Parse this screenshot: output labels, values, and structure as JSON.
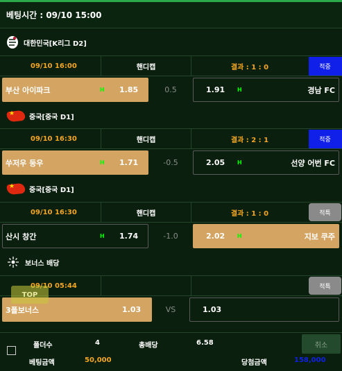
{
  "header": {
    "title": "베팅시간 : 09/10 15:00"
  },
  "matches": [
    {
      "league": "대한민국[K리그 D2]",
      "league_icon": "k-league-icon",
      "time": "09/10 16:00",
      "type": "핸디캡",
      "result": "결과 : 1 : 0",
      "status": "적중",
      "status_color": "#1020e8",
      "home": {
        "team": "부산 아이파크",
        "mark": "H",
        "odd": "1.85",
        "selected": true
      },
      "handicap": "0.5",
      "away": {
        "team": "경남 FC",
        "mark": "H",
        "odd": "1.91",
        "selected": false
      }
    },
    {
      "league": "중국[중국 D1]",
      "league_icon": "china-flag-icon",
      "time": "09/10 16:30",
      "type": "핸디캡",
      "result": "결과 : 2 : 1",
      "status": "적중",
      "status_color": "#1020e8",
      "home": {
        "team": "쑤저우 둥우",
        "mark": "H",
        "odd": "1.71",
        "selected": true
      },
      "handicap": "-0.5",
      "away": {
        "team": "선양 어번 FC",
        "mark": "H",
        "odd": "2.05",
        "selected": false
      }
    },
    {
      "league": "중국[중국 D1]",
      "league_icon": "china-flag-icon",
      "time": "09/10 16:30",
      "type": "핸디캡",
      "result": "결과 : 1 : 0",
      "status": "적특",
      "status_color": "#8a8a8a",
      "home": {
        "team": "산시 창간",
        "mark": "H",
        "odd": "1.74",
        "selected": false
      },
      "handicap": "-1.0",
      "away": {
        "team": "지보 쿠주",
        "mark": "H",
        "odd": "2.02",
        "selected": true
      }
    }
  ],
  "bonus": {
    "league": "보너스 배당",
    "league_icon": "bonus-sparkle-icon",
    "time": "09/10 05:44",
    "status": "적특",
    "home": {
      "team": "3폴보너스",
      "odd": "1.03"
    },
    "vs": "VS",
    "away": {
      "odd": "1.03"
    }
  },
  "top_button": "TOP",
  "footer": {
    "folder_label": "폴더수",
    "folder_value": "4",
    "total_odds_label": "총배당",
    "total_odds_value": "6.58",
    "cancel_label": "취소",
    "bet_amount_label": "베팅금액",
    "bet_amount_value": "50,000",
    "win_amount_label": "당첨금액",
    "win_amount_value": "158,000"
  },
  "colors": {
    "background": "#0a1f0d",
    "selected_box": "#d4a463",
    "accent_orange": "#f5a623",
    "badge_blue": "#1020e8",
    "handicap_mark": "#00ff00"
  }
}
